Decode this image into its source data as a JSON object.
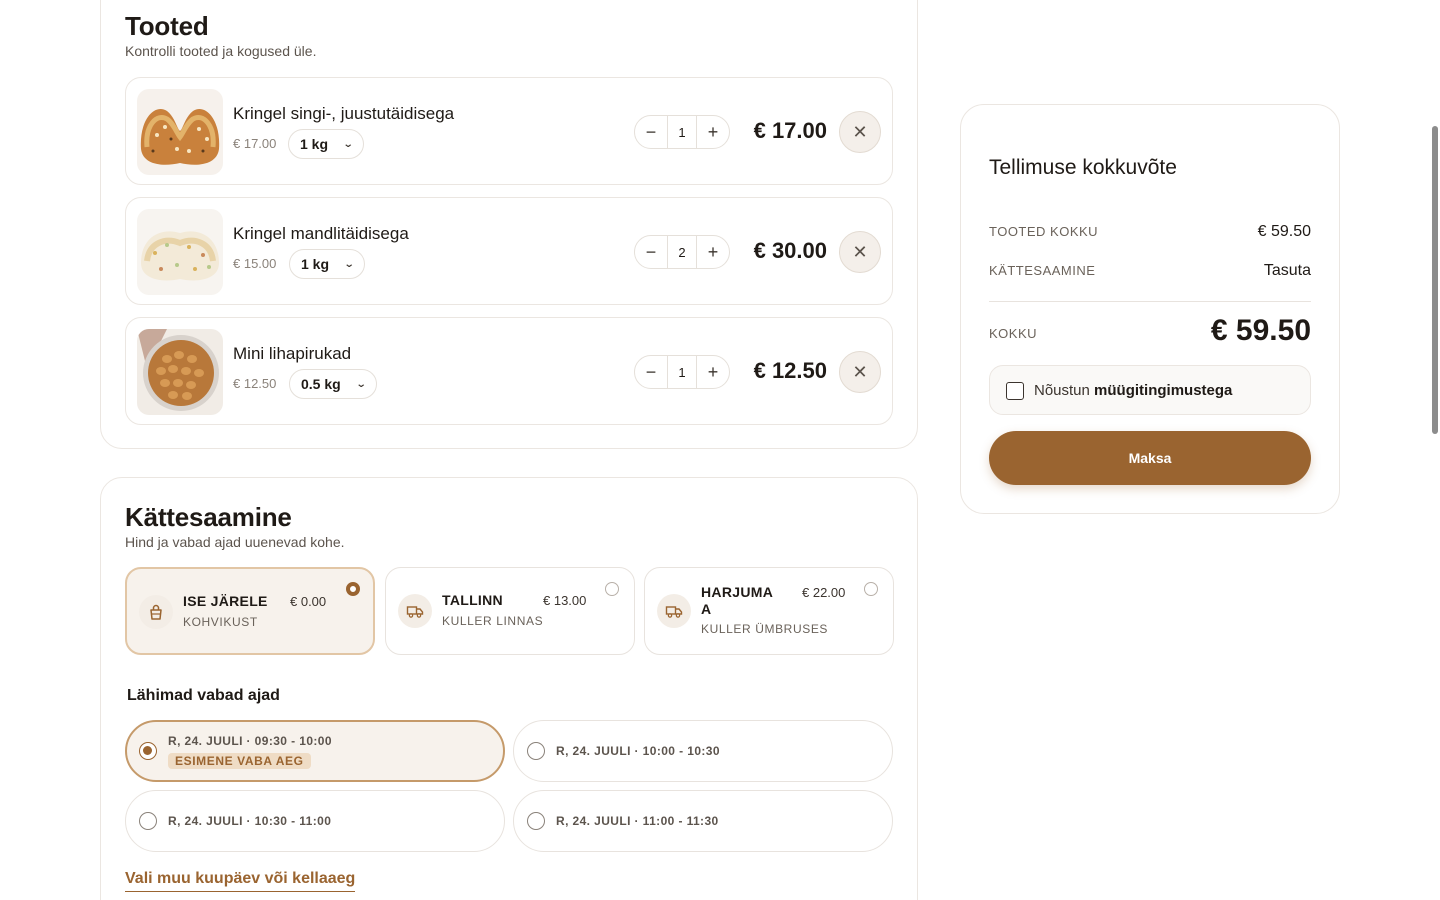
{
  "products_section": {
    "title": "Tooted",
    "subtitle": "Kontrolli tooted ja kogused üle.",
    "items": [
      {
        "name": "Kringel singi-, juustutäidisega",
        "unit_price": "€ 17.00",
        "size": "1 kg",
        "quantity": "1",
        "total": "€ 17.00"
      },
      {
        "name": "Kringel mandlitäidisega",
        "unit_price": "€ 15.00",
        "size": "1 kg",
        "quantity": "2",
        "total": "€ 30.00"
      },
      {
        "name": "Mini lihapirukad",
        "unit_price": "€ 12.50",
        "size": "0.5 kg",
        "quantity": "1",
        "total": "€ 12.50"
      }
    ],
    "minus_symbol": "−",
    "plus_symbol": "+",
    "remove_symbol": "✕",
    "chevron": "⌄"
  },
  "delivery_section": {
    "title": "Kättesaamine",
    "subtitle": "Hind ja vabad ajad uuenevad kohe.",
    "options": [
      {
        "name": "ISE JÄRELE",
        "sub": "KOHVIKUST",
        "price": "€ 0.00",
        "icon": "bag-icon",
        "selected": true
      },
      {
        "name": "TALLINN",
        "sub": "KULLER LINNAS",
        "price": "€ 13.00",
        "icon": "truck-icon",
        "selected": false
      },
      {
        "name_line1": "HARJUMA",
        "name_line2": "A",
        "sub": "KULLER ÜMBRUSES",
        "price": "€ 22.00",
        "icon": "truck-icon",
        "selected": false
      }
    ],
    "slots_title": "Lähimad vabad ajad",
    "slots": [
      {
        "label": "R, 24. JUULI · 09:30 - 10:00",
        "badge": "ESIMENE VABA AEG",
        "selected": true
      },
      {
        "label": "R, 24. JUULI · 10:00 - 10:30",
        "selected": false
      },
      {
        "label": "R, 24. JUULI · 10:30 - 11:00",
        "selected": false
      },
      {
        "label": "R, 24. JUULI · 11:00 - 11:30",
        "selected": false
      }
    ],
    "other_link": "Vali muu kuupäev või kellaaeg"
  },
  "summary": {
    "title": "Tellimuse kokkuvõte",
    "products_total_label": "TOOTED KOKKU",
    "products_total_value": "€ 59.50",
    "delivery_label": "KÄTTESAAMINE",
    "delivery_value": "Tasuta",
    "total_label": "KOKKU",
    "total_value": "€ 59.50",
    "terms_prefix": "Nõustun",
    "terms_link": "müügitingimustega",
    "terms_checked": false,
    "pay_button": "Maksa"
  },
  "colors": {
    "accent": "#9a6430",
    "accent_light": "#f7f2ec",
    "badge_bg": "#efdcc5",
    "text": "#1f1a16",
    "border": "#ebe6e1"
  }
}
